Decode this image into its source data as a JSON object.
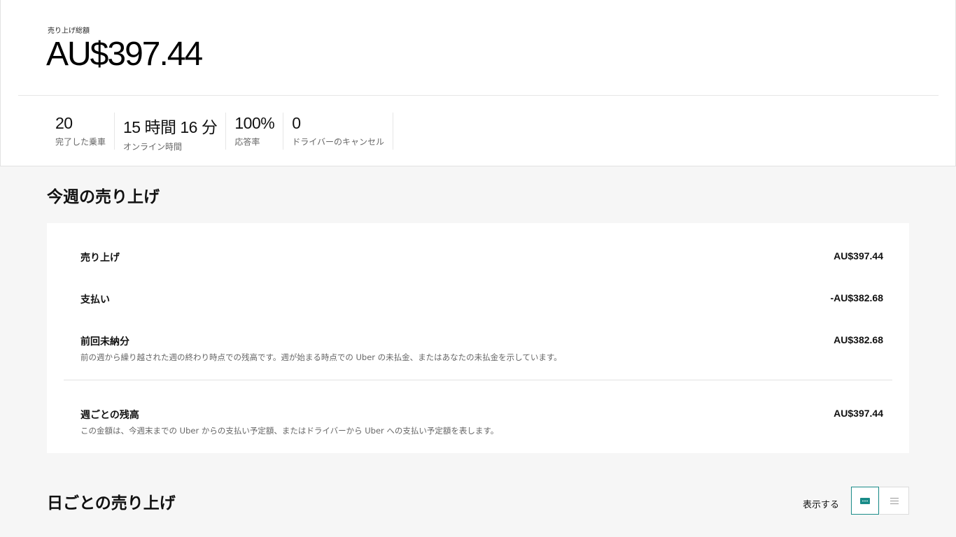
{
  "summary": {
    "total_label": "売り上げ総額",
    "total_value": "AU$397.44",
    "stats": [
      {
        "value": "20",
        "label": "完了した乗車"
      },
      {
        "value": "15 時間 16 分",
        "label": "オンライン時間"
      },
      {
        "value": "100%",
        "label": "応答率"
      },
      {
        "value": "0",
        "label": "ドライバーのキャンセル"
      }
    ]
  },
  "weekly": {
    "title": "今週の売り上げ",
    "rows": [
      {
        "label": "売り上げ",
        "amount": "AU$397.44",
        "desc": ""
      },
      {
        "label": "支払い",
        "amount": "-AU$382.68",
        "desc": ""
      },
      {
        "label": "前回未納分",
        "amount": "AU$382.68",
        "desc": "前の週から繰り越された週の終わり時点での残高です。週が始まる時点での Uber の未払金、またはあなたの未払金を示しています。"
      },
      {
        "label": "週ごとの残高",
        "amount": "AU$397.44",
        "desc": "この金額は、今週末までの Uber からの支払い予定額、またはドライバーから Uber への支払い予定額を表します。"
      }
    ]
  },
  "daily": {
    "title": "日ごとの売り上げ",
    "view_label": "表示する",
    "views": [
      {
        "icon": "chart-view-icon",
        "selected": true
      },
      {
        "icon": "list-view-icon",
        "selected": false
      }
    ]
  },
  "colors": {
    "accent": "#1a8c89",
    "background": "#f6f6f6"
  }
}
